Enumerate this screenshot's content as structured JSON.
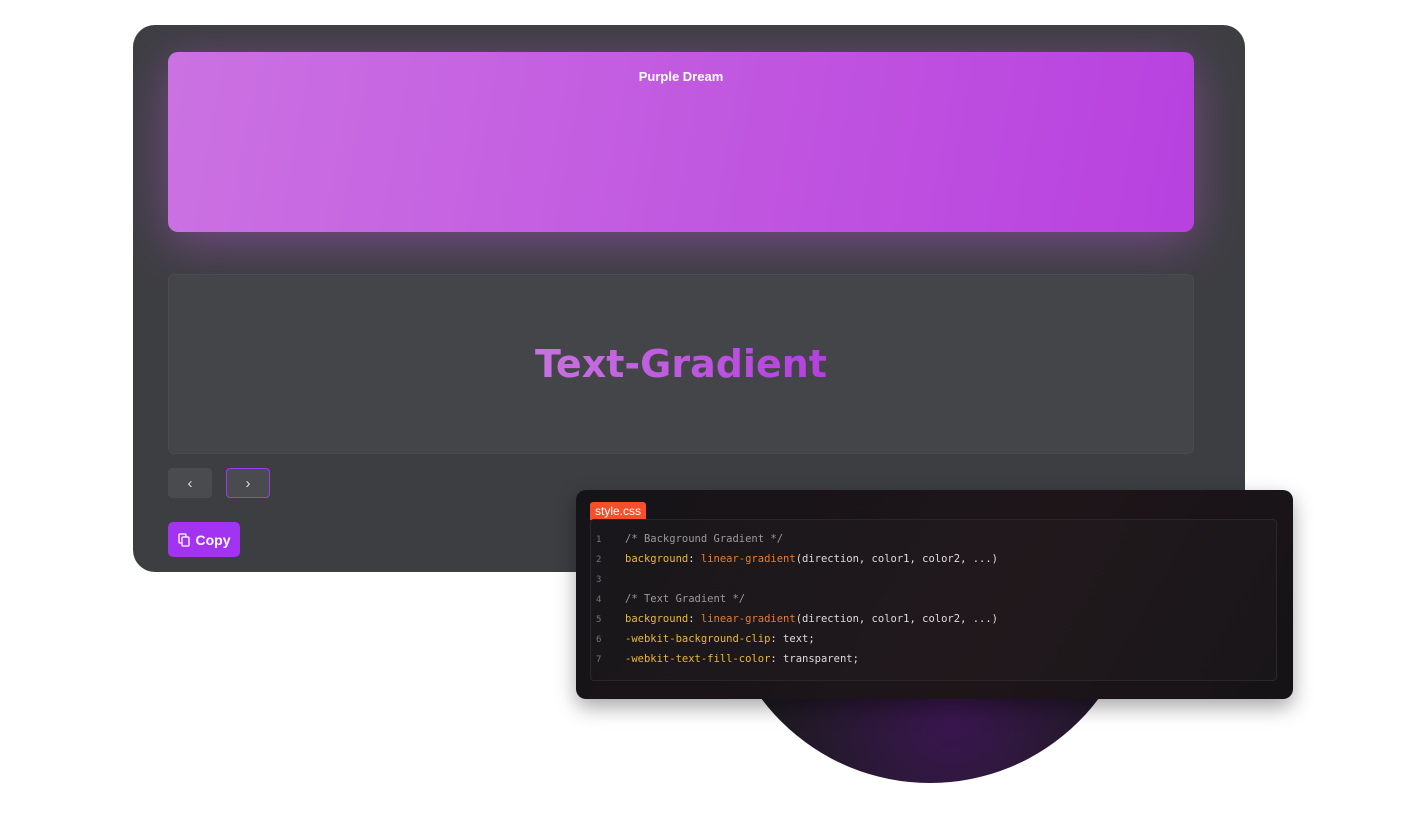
{
  "preview": {
    "title": "Purple Dream",
    "gradient": [
      "#cb72e2",
      "#b841df"
    ]
  },
  "text_preview": {
    "text": "Text-Gradient"
  },
  "nav": {
    "prev": "‹",
    "next": "›"
  },
  "copy_button": {
    "label": "Copy",
    "icon": "copy-icon",
    "color": "#a233f0"
  },
  "code": {
    "filename": "style.css",
    "lines": [
      {
        "n": "1",
        "parts": [
          {
            "t": "/* Background Gradient */",
            "c": "cm"
          }
        ]
      },
      {
        "n": "2",
        "parts": [
          {
            "t": "background",
            "c": "pr"
          },
          {
            "t": ": ",
            "c": ""
          },
          {
            "t": "linear-gradient",
            "c": "fn"
          },
          {
            "t": "(direction, color1, color2, ...)",
            "c": ""
          }
        ]
      },
      {
        "n": "3",
        "parts": []
      },
      {
        "n": "4",
        "parts": [
          {
            "t": "/* Text Gradient */",
            "c": "cm"
          }
        ]
      },
      {
        "n": "5",
        "parts": [
          {
            "t": "background",
            "c": "pr"
          },
          {
            "t": ": ",
            "c": ""
          },
          {
            "t": "linear-gradient",
            "c": "fn"
          },
          {
            "t": "(direction, color1, color2, ...)",
            "c": ""
          }
        ]
      },
      {
        "n": "6",
        "parts": [
          {
            "t": "-webkit-background-clip",
            "c": "pr"
          },
          {
            "t": ": text;",
            "c": ""
          }
        ]
      },
      {
        "n": "7",
        "parts": [
          {
            "t": "-webkit-text-fill-color",
            "c": "pr"
          },
          {
            "t": ": transparent;",
            "c": ""
          }
        ]
      }
    ]
  }
}
